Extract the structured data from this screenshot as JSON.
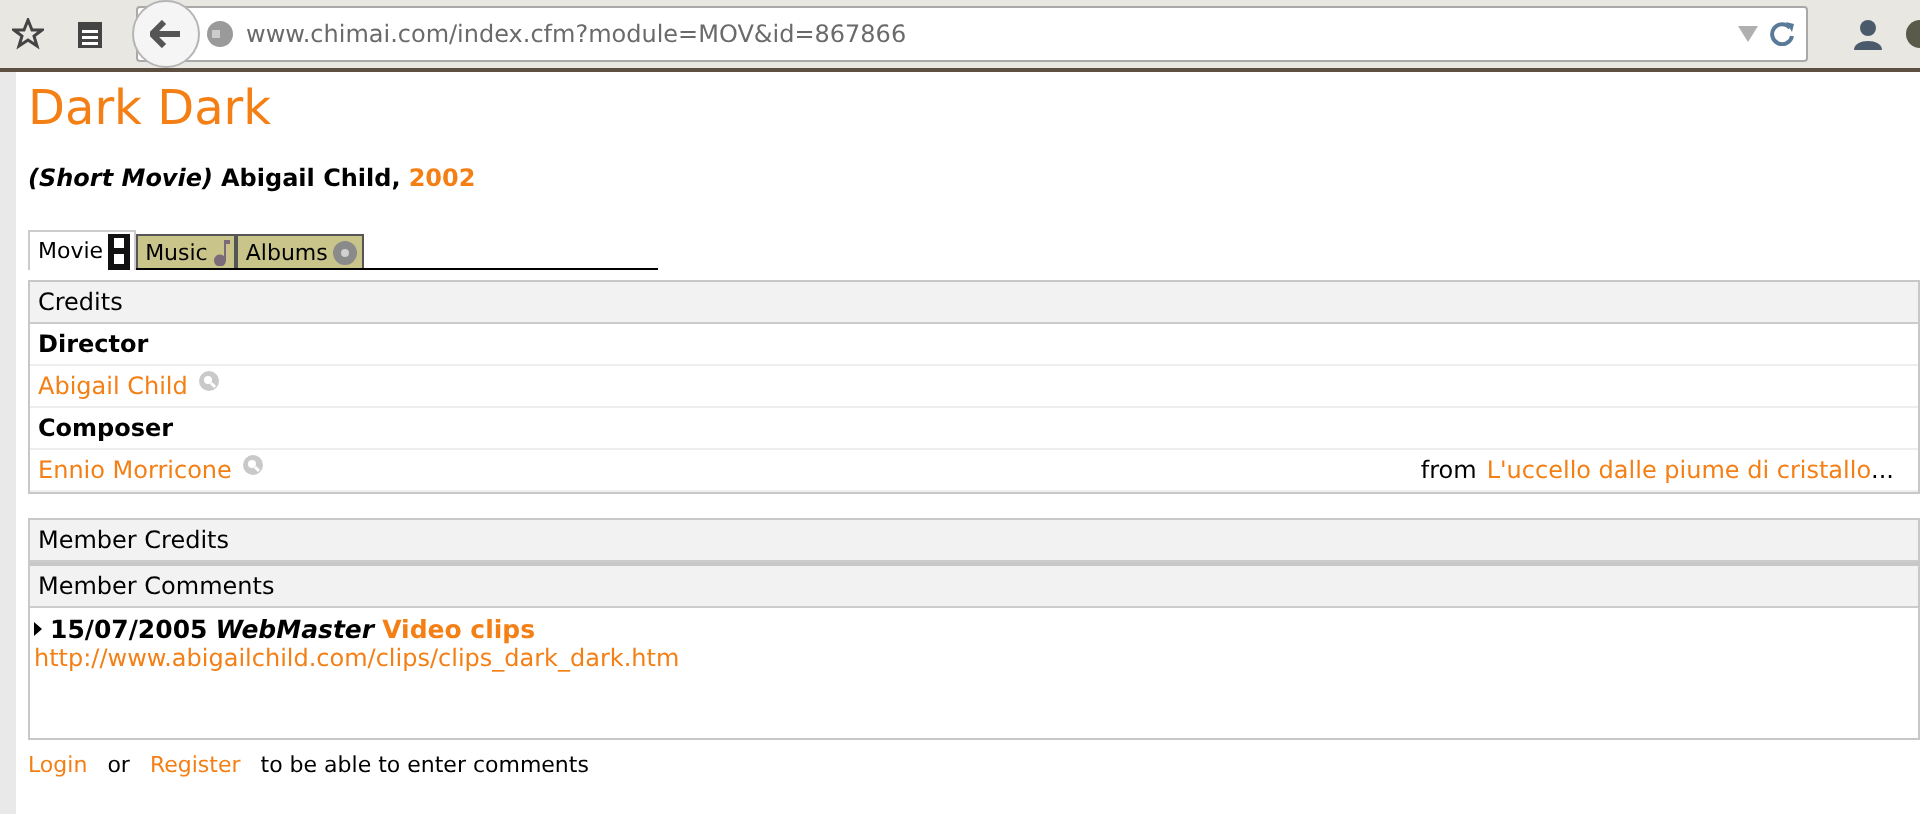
{
  "browser": {
    "url": "www.chimai.com/index.cfm?module=MOV&id=867866"
  },
  "title": "Dark Dark",
  "subtitle": {
    "kind_label": "(Short Movie)",
    "author": "Abigail Child,",
    "year": "2002"
  },
  "tabs": [
    {
      "label": "Movie",
      "selected": true
    },
    {
      "label": "Music",
      "selected": false
    },
    {
      "label": "Albums",
      "selected": false
    }
  ],
  "credits": {
    "header": "Credits",
    "rows": [
      {
        "kind": "role",
        "text": "Director"
      },
      {
        "kind": "person",
        "text": "Abigail Child"
      },
      {
        "kind": "role",
        "text": "Composer"
      },
      {
        "kind": "person",
        "text": "Ennio Morricone",
        "note": {
          "prefix": "from",
          "link": "L'uccello dalle piume di cristallo",
          "suffix": "..."
        }
      }
    ]
  },
  "member_credits": {
    "header": "Member Credits"
  },
  "member_comments": {
    "header": "Member Comments",
    "comments": [
      {
        "date": "15/07/2005",
        "author": "WebMaster",
        "title": "Video clips",
        "body": "http://www.abigailchild.com/clips/clips_dark_dark.htm"
      }
    ]
  },
  "footer": {
    "login": "Login",
    "or": "or",
    "register": "Register",
    "rest": "to be able to enter comments"
  }
}
